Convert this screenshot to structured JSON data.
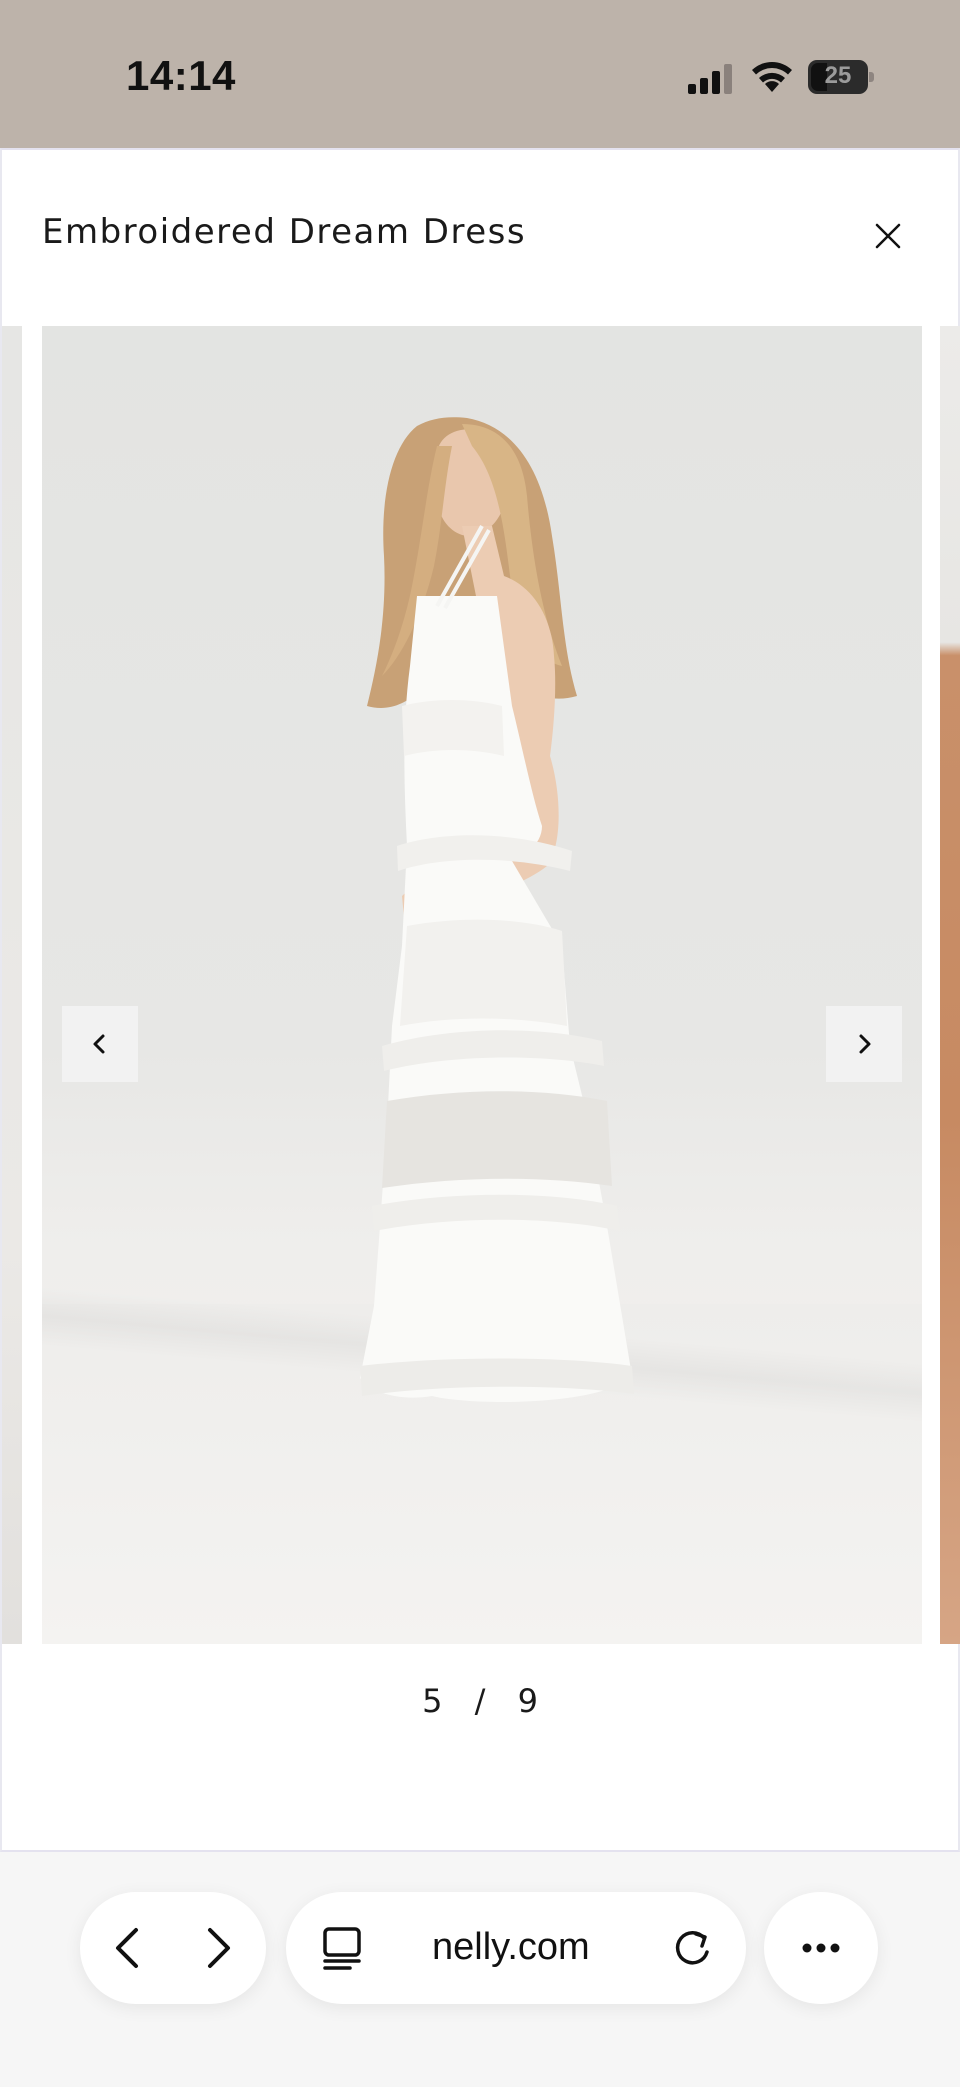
{
  "status_bar": {
    "time": "14:14",
    "battery": "25",
    "icons": [
      "signal-icon",
      "wifi-icon",
      "battery-icon"
    ]
  },
  "modal": {
    "title": "Embroidered Dream Dress",
    "close_icon": "close-icon"
  },
  "gallery": {
    "current": "5",
    "separator": "/",
    "total": "9",
    "prev_icon": "chevron-left-icon",
    "next_icon": "chevron-right-icon"
  },
  "browser": {
    "url": "nelly.com",
    "icons": [
      "back-icon",
      "forward-icon",
      "tabs-icon",
      "reload-icon",
      "more-icon"
    ]
  },
  "colors": {
    "status_bar_bg": "#bdb3aa",
    "modal_bg": "#ffffff",
    "nav_button_bg": "#f2f2f2",
    "browser_bar_bg": "#f6f6f6"
  }
}
